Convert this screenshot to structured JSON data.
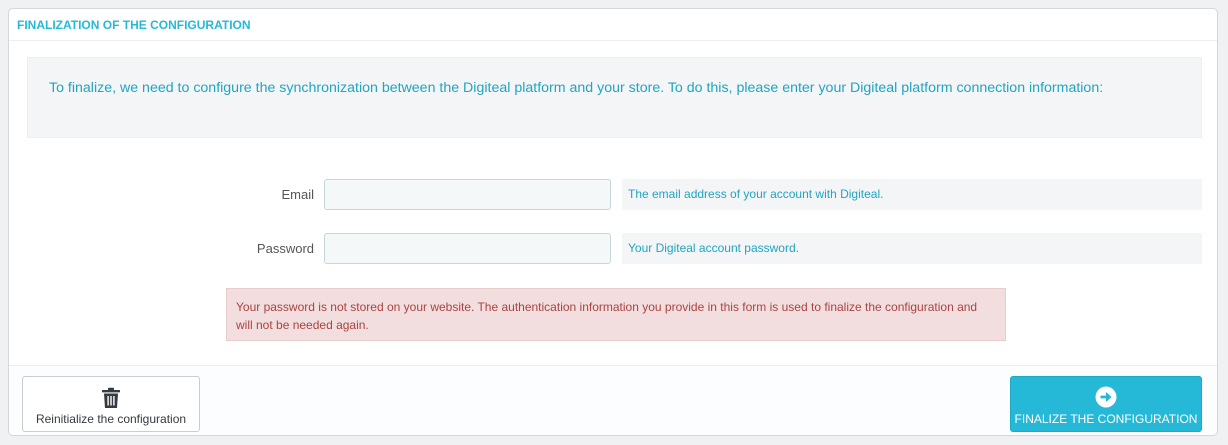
{
  "panel": {
    "title": "FINALIZATION OF THE CONFIGURATION",
    "accent_color": "#25b9d7"
  },
  "intro": {
    "text": "To finalize, we need to configure the synchronization between the Digiteal platform and your store. To do this, please enter your Digiteal platform connection information:"
  },
  "form": {
    "email": {
      "label": "Email",
      "value": "",
      "placeholder": "",
      "help": "The email address of your account with Digiteal."
    },
    "password": {
      "label": "Password",
      "value": "",
      "placeholder": "",
      "help": "Your Digiteal account password."
    }
  },
  "alert": {
    "text": "Your password is not stored on your website. The authentication information you provide in this form is used to finalize the configuration and will not be needed again.",
    "color": "#a94442"
  },
  "footer": {
    "reset_label": "Reinitialize the configuration",
    "reset_icon": "trash-icon",
    "finalize_label": "FINALIZE THE CONFIGURATION",
    "finalize_icon": "arrow-circle-right-icon"
  }
}
